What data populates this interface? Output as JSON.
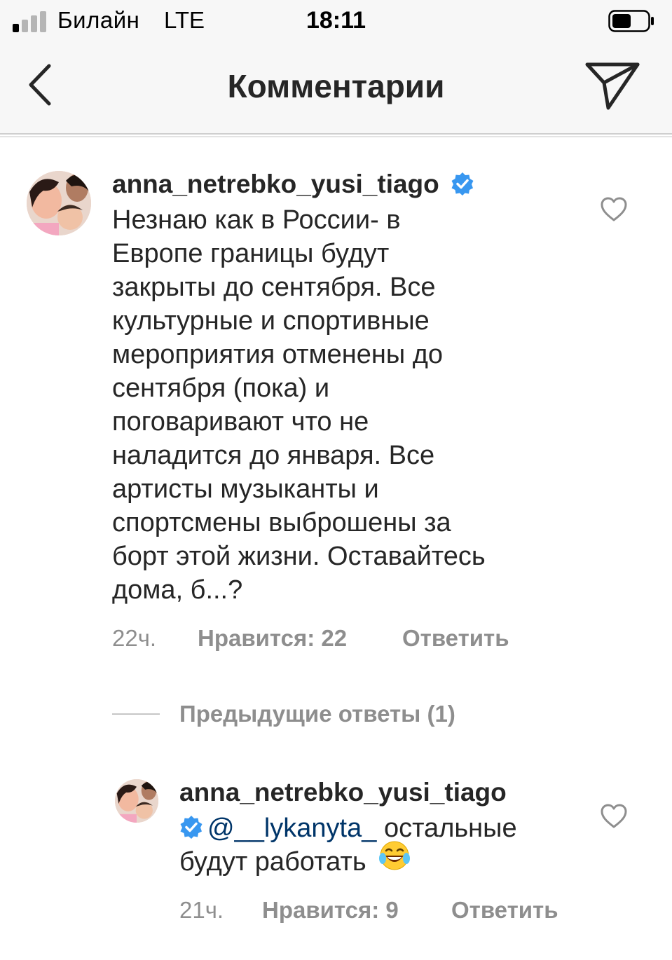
{
  "status_bar": {
    "carrier": "Билайн",
    "network": "LTE",
    "time": "18:11",
    "signal_bars_filled": 1,
    "signal_bars_total": 4
  },
  "nav": {
    "title": "Комментарии"
  },
  "comments": [
    {
      "username": "anna_netrebko_yusi_tiago",
      "verified": true,
      "text_lines": [
        "Незнаю как в России- в",
        "Европе границы будут",
        "закрыты до сентября. Все",
        "культурные и спортивные",
        "мероприятия отменены до",
        "сентября (пока) и",
        "поговаривают что не",
        "наладится до января. Все",
        "артисты музыканты и",
        "спортсмены выброшены за",
        "борт этой жизни. Оставайтесь",
        "дома, б...?"
      ],
      "time": "22ч.",
      "likes": "Нравится: 22",
      "reply": "Ответить"
    }
  ],
  "replies_toggle": "Предыдущие ответы (1)",
  "reply_comment": {
    "username": "anna_netrebko_yusi_tiago",
    "verified": true,
    "mention": "@__lykanyta_",
    "text_after_mention": " остальные",
    "text_line2": "будут работать",
    "emoji": "😂",
    "time": "21ч.",
    "likes": "Нравится: 9",
    "reply": "Ответить"
  },
  "colors": {
    "text": "#262626",
    "secondary": "#8e8e8e",
    "verified_blue": "#3897f0",
    "mention": "#003569",
    "bar_background": "#f7f7f7"
  },
  "icons": [
    "back-chevron-icon",
    "direct-share-icon",
    "heart-icon",
    "verified-badge-icon",
    "signal-icon",
    "battery-icon"
  ]
}
